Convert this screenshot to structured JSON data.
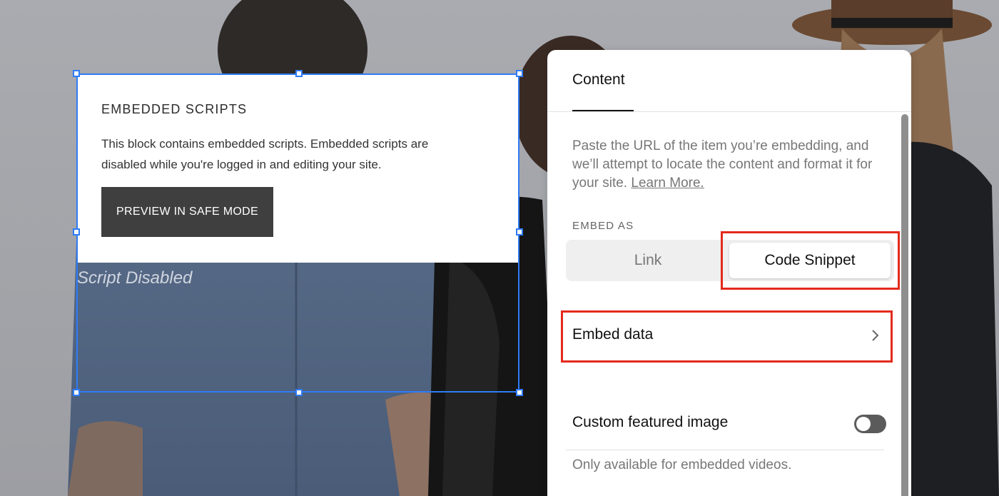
{
  "canvas": {
    "embed_block": {
      "title": "EMBEDDED SCRIPTS",
      "description": "This block contains embedded scripts. Embedded scripts are disabled while you're logged in and editing your site.",
      "preview_button_label": "PREVIEW IN SAFE MODE",
      "disabled_caption": "Script Disabled"
    }
  },
  "panel": {
    "tab_label": "Content",
    "help_text": "Paste the URL of the item you’re embedding, and we’ll attempt to locate the content and format it for your site.",
    "learn_more_label": "Learn More.",
    "embed_as_label": "EMBED AS",
    "embed_as_options": [
      {
        "label": "Link",
        "selected": false
      },
      {
        "label": "Code Snippet",
        "selected": true
      }
    ],
    "embed_data_label": "Embed data",
    "custom_featured_image": {
      "label": "Custom featured image",
      "enabled": false,
      "help": "Only available for embedded videos."
    }
  },
  "colors": {
    "selection_outline": "#2f7cf6",
    "annotation_highlight": "#e32a1c",
    "button_dark": "#3f3f3f"
  },
  "icons": {
    "embed_data_chevron": "chevron-right-icon"
  }
}
